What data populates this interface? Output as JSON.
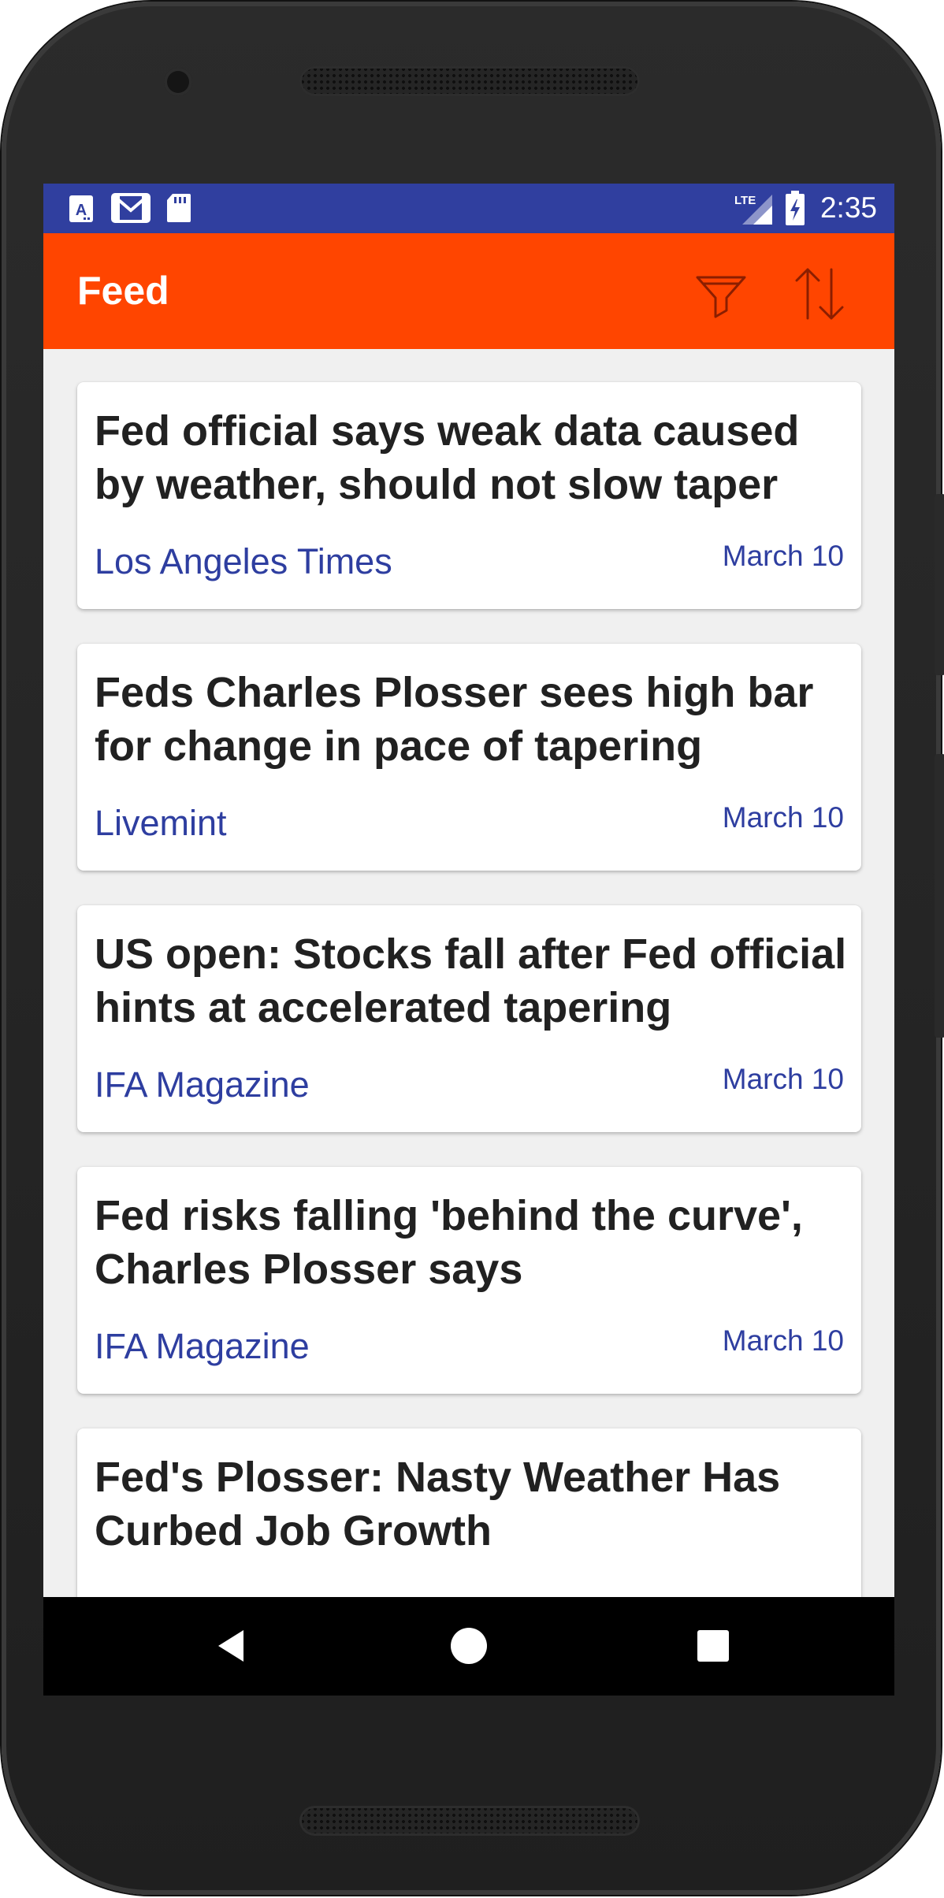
{
  "status_bar": {
    "time": "2:35",
    "network": "LTE",
    "icons": [
      "text-notification-icon",
      "gmail-icon",
      "sd-card-icon",
      "lte-signal-icon",
      "battery-charging-icon"
    ]
  },
  "app_bar": {
    "title": "Feed",
    "actions": [
      "filter-icon",
      "sort-icon"
    ],
    "color": "#ff4500"
  },
  "feed": {
    "items": [
      {
        "title": "Fed official says weak data caused by weather, should not slow taper",
        "source": "Los Angeles Times",
        "date": "March 10"
      },
      {
        "title": "Feds Charles Plosser sees high bar for change in pace of tapering",
        "source": "Livemint",
        "date": "March 10"
      },
      {
        "title": "US open: Stocks fall after Fed official hints at accelerated tapering",
        "source": "IFA Magazine",
        "date": "March 10"
      },
      {
        "title": "Fed risks falling 'behind the curve', Charles Plosser says",
        "source": "IFA Magazine",
        "date": "March 10"
      },
      {
        "title": "Fed's Plosser: Nasty Weather Has Curbed Job Growth",
        "source": "",
        "date": ""
      }
    ]
  },
  "nav_bar": {
    "buttons": [
      "back-icon",
      "home-icon",
      "recents-icon"
    ]
  },
  "colors": {
    "status_bar": "#303f9f",
    "app_bar": "#ff4500",
    "link_text": "#2e3ea0",
    "title_text": "#212121"
  }
}
